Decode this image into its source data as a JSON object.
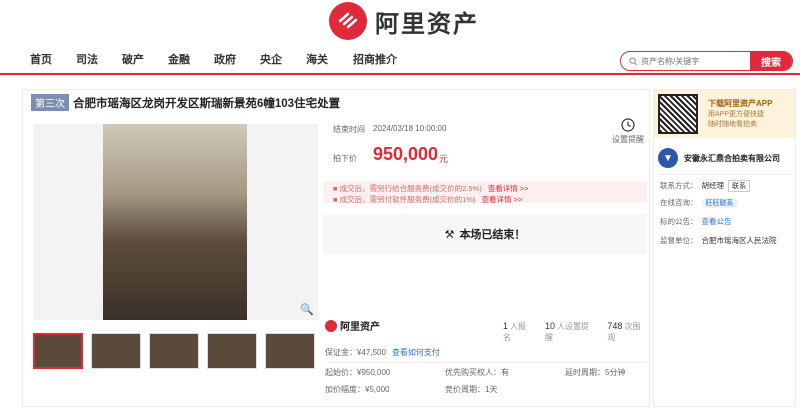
{
  "brand": {
    "name": "阿里资产"
  },
  "nav": {
    "items": [
      "首页",
      "司法",
      "破产",
      "金融",
      "政府",
      "央企",
      "海关",
      "招商推介"
    ],
    "search_placeholder": "资产名称/关键字",
    "search_button": "搜索"
  },
  "item": {
    "round_badge": "第三次",
    "title": "合肥市瑶海区龙岗开发区斯瑞新景苑6幢103住宅处置",
    "end_time_label": "结束时间",
    "end_time": "2024/03/18 10:00:00",
    "remind_label": "设置提醒",
    "price_label": "拍下价",
    "price": "950,000",
    "price_unit": "元",
    "fee1": "成交后，需另行给合服务费(成交价的2.5%)",
    "fee2": "成交后，需另付软件服务费(成交价的1%)",
    "fee_link": "查看详情 >>",
    "ended_text": "本场已结束！",
    "bottom_brand": "阿里资产",
    "stats": [
      {
        "n": "1",
        "label": "人报名"
      },
      {
        "n": "10",
        "label": "人设置提醒"
      },
      {
        "n": "748",
        "label": "次围观"
      }
    ],
    "deposit_label": "保证金：¥47,500",
    "deposit_link": "查看如何支付",
    "grid": [
      [
        "起始价：¥950,000",
        "优先购买权人：有",
        "延时周期：5分钟"
      ],
      [
        "加价幅度：¥5,000",
        "竞价周期：1天",
        ""
      ]
    ]
  },
  "sidebar": {
    "app_title": "下载阿里资产APP",
    "app_desc_1": "用APP更方便快捷",
    "app_desc_2": "随时随地看拍卖",
    "org_name": "安徽永汇鼎合拍卖有限公司",
    "contact_label": "联系方式：",
    "contact_name": "胡经理",
    "contact_tag": "联系",
    "online_label": "在线咨询：",
    "online_tag": "旺旺联系",
    "notice_label": "标的公告：",
    "notice_link": "查看公告",
    "supervisor_label": "监督单位：",
    "supervisor": "合肥市瑶海区人民法院"
  },
  "colors": {
    "accent": "#e0293a"
  }
}
